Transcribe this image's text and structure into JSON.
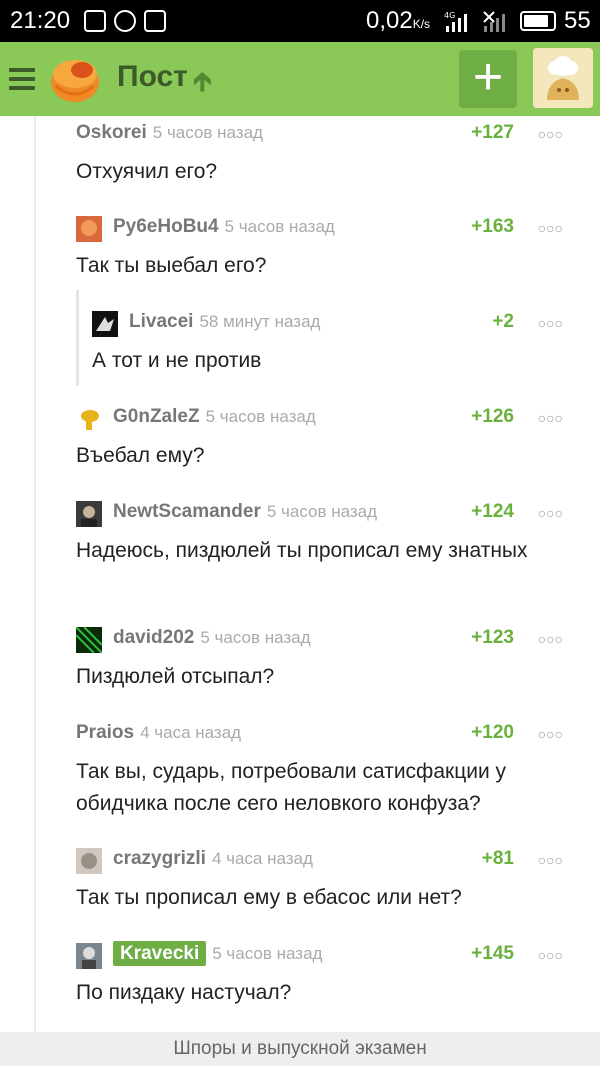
{
  "status_bar": {
    "time": "21:20",
    "network_speed": "0,02",
    "network_speed_unit": "K/s",
    "network_type": "4G",
    "battery": "55"
  },
  "app_bar": {
    "title": "Пост",
    "colors": {
      "bar": "#8ac858",
      "accent": "#69b13c"
    }
  },
  "comments": [
    {
      "user": "Oskorei",
      "time": "5 часов назад",
      "score": "+127",
      "text": "Отхуячил его?"
    },
    {
      "user": "Py6eHoBu4",
      "time": "5 часов назад",
      "score": "+163",
      "text": "Так ты выебал его?"
    },
    {
      "user": "Livacei",
      "time": "58 минут назад",
      "score": "+2",
      "text": "А тот и не против"
    },
    {
      "user": "G0nZaleZ",
      "time": "5 часов назад",
      "score": "+126",
      "text": "Въебал ему?"
    },
    {
      "user": "NewtScamander",
      "time": "5 часов назад",
      "score": "+124",
      "text": "Надеюсь, пиздюлей ты прописал ему знатных"
    },
    {
      "user": "david202",
      "time": "5 часов назад",
      "score": "+123",
      "text": "Пиздюлей отсыпал?"
    },
    {
      "user": "Praios",
      "time": "4 часа назад",
      "score": "+120",
      "text": "Так вы, сударь, потребовали сатисфакции у обидчика после сего неловкого конфуза?"
    },
    {
      "user": "crazygrizli",
      "time": "4 часа назад",
      "score": "+81",
      "text": "Так ты прописал ему в ебасос или нет?"
    },
    {
      "user": "Kravecki",
      "time": "5 часов назад",
      "score": "+145",
      "text": "По пиздаку настучал?"
    }
  ],
  "footer": {
    "text": "Шпоры и выпускной экзамен"
  }
}
